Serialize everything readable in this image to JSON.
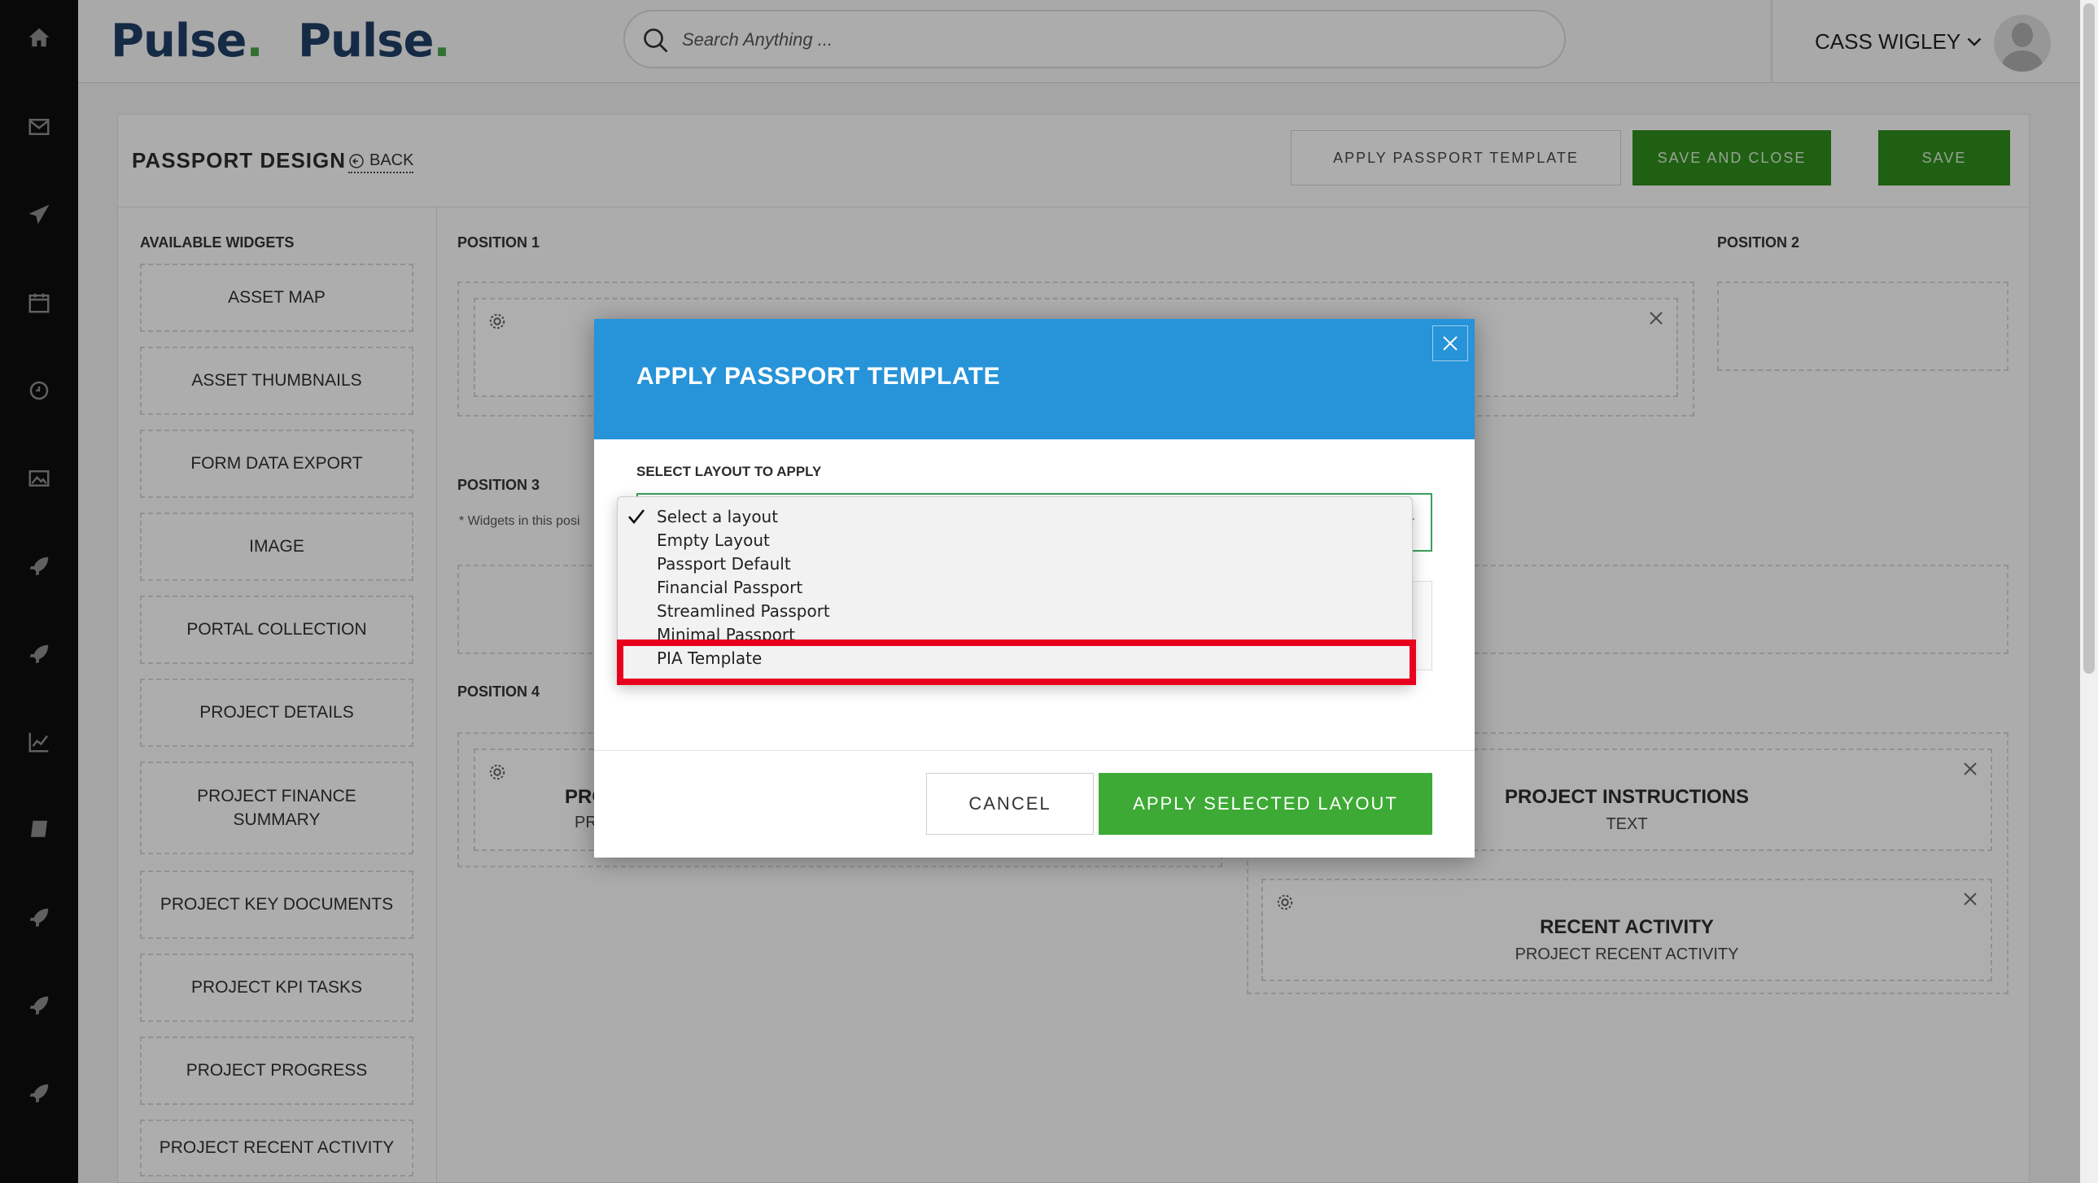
{
  "header": {
    "logos": [
      "Pulse",
      "Pulse"
    ],
    "search_placeholder": "Search Anything ...",
    "user_name": "CASS WIGLEY"
  },
  "rail": {
    "icons": [
      "home-icon",
      "mail-icon",
      "send-icon",
      "calendar-icon",
      "clock-icon",
      "image-icon",
      "rocket-icon",
      "rocket-icon",
      "chart-icon",
      "book-icon",
      "rocket-icon",
      "rocket-icon",
      "rocket-icon"
    ]
  },
  "page": {
    "title": "PASSPORT DESIGN",
    "back_label": "BACK",
    "apply_template_label": "APPLY PASSPORT TEMPLATE",
    "save_close_label": "SAVE AND CLOSE",
    "save_label": "SAVE"
  },
  "widgets": {
    "header": "AVAILABLE WIDGETS",
    "items": [
      "ASSET MAP",
      "ASSET THUMBNAILS",
      "FORM DATA EXPORT",
      "IMAGE",
      "PORTAL COLLECTION",
      "PROJECT DETAILS",
      "PROJECT FINANCE SUMMARY",
      "PROJECT KEY DOCUMENTS",
      "PROJECT KPI TASKS",
      "PROJECT PROGRESS",
      "PROJECT RECENT ACTIVITY"
    ]
  },
  "positions": {
    "p1": "POSITION 1",
    "p2": "POSITION 2",
    "p3": "POSITION 3",
    "p3_note": "* Widgets in this posi",
    "p4": "POSITION 4",
    "card_partial_title": "PRO",
    "card_partial_sub": "PR",
    "instructions_title": "PROJECT INSTRUCTIONS",
    "instructions_sub": "TEXT",
    "activity_title": "RECENT ACTIVITY",
    "activity_sub": "PROJECT RECENT ACTIVITY"
  },
  "modal": {
    "title": "APPLY PASSPORT TEMPLATE",
    "select_label": "SELECT LAYOUT TO APPLY",
    "selected_value": "Select a layout",
    "options": [
      "Select a layout",
      "Empty Layout",
      "Passport Default",
      "Financial Passport",
      "Streamlined Passport",
      "Minimal Passport",
      "PIA Template"
    ],
    "highlighted_option": "PIA Template",
    "cancel_label": "CANCEL",
    "apply_label": "APPLY SELECTED LAYOUT"
  },
  "colors": {
    "modal_header": "#2793d8",
    "apply_green": "#3caa34",
    "save_green": "#2f8a1c",
    "highlight_red": "#e8001c"
  }
}
